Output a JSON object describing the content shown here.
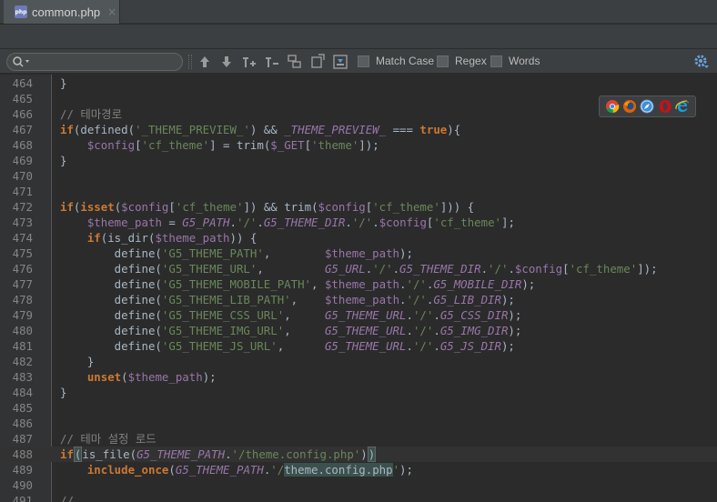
{
  "tab": {
    "label": "common.php",
    "close": "×",
    "icon": "php-file-icon",
    "icon_text": "php"
  },
  "search": {
    "value": "",
    "placeholder": "",
    "options": [
      {
        "label": "Match Case",
        "checked": false
      },
      {
        "label": "Regex",
        "checked": false
      },
      {
        "label": "Words",
        "checked": false
      }
    ]
  },
  "toolbar_icons": [
    "previous-occurrence-icon",
    "next-occurrence-icon",
    "add-occurrence-icon",
    "remove-occurrence-icon",
    "select-all-occurrences-icon",
    "filter-icon",
    "in-selection-icon"
  ],
  "browsers": [
    "chrome-icon",
    "firefox-icon",
    "safari-icon",
    "opera-icon",
    "ie-icon"
  ],
  "colors": {
    "keyword": "#cc7832",
    "string": "#6a8759",
    "variable": "#9876aa",
    "comment": "#808080",
    "text": "#a9b7c6",
    "background": "#2b2b2b",
    "gutter": "#313335"
  },
  "editor": {
    "current_line": 488,
    "lines": [
      {
        "n": "464",
        "tokens": [
          [
            "op",
            "}"
          ]
        ]
      },
      {
        "n": "465",
        "tokens": []
      },
      {
        "n": "466",
        "tokens": [
          [
            "cm",
            "// 테마경로"
          ]
        ]
      },
      {
        "n": "467",
        "tokens": [
          [
            "kw",
            "if"
          ],
          [
            "op",
            "(defined("
          ],
          [
            "str",
            "'_THEME_PREVIEW_'"
          ],
          [
            "op",
            ") && "
          ],
          [
            "const",
            "_THEME_PREVIEW_"
          ],
          [
            "op",
            " === "
          ],
          [
            "kw",
            "true"
          ],
          [
            "op",
            "){"
          ]
        ]
      },
      {
        "n": "468",
        "tokens": [
          [
            "op",
            "    "
          ],
          [
            "var",
            "$config"
          ],
          [
            "op",
            "["
          ],
          [
            "str",
            "'cf_theme'"
          ],
          [
            "op",
            "] = trim("
          ],
          [
            "var",
            "$_GET"
          ],
          [
            "op",
            "["
          ],
          [
            "str",
            "'theme'"
          ],
          [
            "op",
            "]);"
          ]
        ]
      },
      {
        "n": "469",
        "tokens": [
          [
            "op",
            "}"
          ]
        ]
      },
      {
        "n": "470",
        "tokens": []
      },
      {
        "n": "471",
        "tokens": []
      },
      {
        "n": "472",
        "tokens": [
          [
            "kw",
            "if"
          ],
          [
            "op",
            "("
          ],
          [
            "kw",
            "isset"
          ],
          [
            "op",
            "("
          ],
          [
            "var",
            "$config"
          ],
          [
            "op",
            "["
          ],
          [
            "str",
            "'cf_theme'"
          ],
          [
            "op",
            "]) && trim("
          ],
          [
            "var",
            "$config"
          ],
          [
            "op",
            "["
          ],
          [
            "str",
            "'cf_theme'"
          ],
          [
            "op",
            "])) {"
          ]
        ]
      },
      {
        "n": "473",
        "tokens": [
          [
            "op",
            "    "
          ],
          [
            "var",
            "$theme_path"
          ],
          [
            "op",
            " = "
          ],
          [
            "const",
            "G5_PATH"
          ],
          [
            "op",
            "."
          ],
          [
            "str",
            "'/'"
          ],
          [
            "op",
            "."
          ],
          [
            "const",
            "G5_THEME_DIR"
          ],
          [
            "op",
            "."
          ],
          [
            "str",
            "'/'"
          ],
          [
            "op",
            "."
          ],
          [
            "var",
            "$config"
          ],
          [
            "op",
            "["
          ],
          [
            "str",
            "'cf_theme'"
          ],
          [
            "op",
            "];"
          ]
        ]
      },
      {
        "n": "474",
        "tokens": [
          [
            "op",
            "    "
          ],
          [
            "kw",
            "if"
          ],
          [
            "op",
            "(is_dir("
          ],
          [
            "var",
            "$theme_path"
          ],
          [
            "op",
            ")) {"
          ]
        ]
      },
      {
        "n": "475",
        "tokens": [
          [
            "op",
            "        define("
          ],
          [
            "str",
            "'G5_THEME_PATH'"
          ],
          [
            "op",
            ",        "
          ],
          [
            "var",
            "$theme_path"
          ],
          [
            "op",
            ");"
          ]
        ]
      },
      {
        "n": "476",
        "tokens": [
          [
            "op",
            "        define("
          ],
          [
            "str",
            "'G5_THEME_URL'"
          ],
          [
            "op",
            ",         "
          ],
          [
            "const",
            "G5_URL"
          ],
          [
            "op",
            "."
          ],
          [
            "str",
            "'/'"
          ],
          [
            "op",
            "."
          ],
          [
            "const",
            "G5_THEME_DIR"
          ],
          [
            "op",
            "."
          ],
          [
            "str",
            "'/'"
          ],
          [
            "op",
            "."
          ],
          [
            "var",
            "$config"
          ],
          [
            "op",
            "["
          ],
          [
            "str",
            "'cf_theme'"
          ],
          [
            "op",
            "]);"
          ]
        ]
      },
      {
        "n": "477",
        "tokens": [
          [
            "op",
            "        define("
          ],
          [
            "str",
            "'G5_THEME_MOBILE_PATH'"
          ],
          [
            "op",
            ", "
          ],
          [
            "var",
            "$theme_path"
          ],
          [
            "op",
            "."
          ],
          [
            "str",
            "'/'"
          ],
          [
            "op",
            "."
          ],
          [
            "const",
            "G5_MOBILE_DIR"
          ],
          [
            "op",
            ");"
          ]
        ]
      },
      {
        "n": "478",
        "tokens": [
          [
            "op",
            "        define("
          ],
          [
            "str",
            "'G5_THEME_LIB_PATH'"
          ],
          [
            "op",
            ",    "
          ],
          [
            "var",
            "$theme_path"
          ],
          [
            "op",
            "."
          ],
          [
            "str",
            "'/'"
          ],
          [
            "op",
            "."
          ],
          [
            "const",
            "G5_LIB_DIR"
          ],
          [
            "op",
            ");"
          ]
        ]
      },
      {
        "n": "479",
        "tokens": [
          [
            "op",
            "        define("
          ],
          [
            "str",
            "'G5_THEME_CSS_URL'"
          ],
          [
            "op",
            ",     "
          ],
          [
            "const",
            "G5_THEME_URL"
          ],
          [
            "op",
            "."
          ],
          [
            "str",
            "'/'"
          ],
          [
            "op",
            "."
          ],
          [
            "const",
            "G5_CSS_DIR"
          ],
          [
            "op",
            ");"
          ]
        ]
      },
      {
        "n": "480",
        "tokens": [
          [
            "op",
            "        define("
          ],
          [
            "str",
            "'G5_THEME_IMG_URL'"
          ],
          [
            "op",
            ",     "
          ],
          [
            "const",
            "G5_THEME_URL"
          ],
          [
            "op",
            "."
          ],
          [
            "str",
            "'/'"
          ],
          [
            "op",
            "."
          ],
          [
            "const",
            "G5_IMG_DIR"
          ],
          [
            "op",
            ");"
          ]
        ]
      },
      {
        "n": "481",
        "tokens": [
          [
            "op",
            "        define("
          ],
          [
            "str",
            "'G5_THEME_JS_URL'"
          ],
          [
            "op",
            ",      "
          ],
          [
            "const",
            "G5_THEME_URL"
          ],
          [
            "op",
            "."
          ],
          [
            "str",
            "'/'"
          ],
          [
            "op",
            "."
          ],
          [
            "const",
            "G5_JS_DIR"
          ],
          [
            "op",
            ");"
          ]
        ]
      },
      {
        "n": "482",
        "tokens": [
          [
            "op",
            "    }"
          ]
        ]
      },
      {
        "n": "483",
        "tokens": [
          [
            "op",
            "    "
          ],
          [
            "kw",
            "unset"
          ],
          [
            "op",
            "("
          ],
          [
            "var",
            "$theme_path"
          ],
          [
            "op",
            ");"
          ]
        ]
      },
      {
        "n": "484",
        "tokens": [
          [
            "op",
            "}"
          ]
        ]
      },
      {
        "n": "485",
        "tokens": []
      },
      {
        "n": "486",
        "tokens": []
      },
      {
        "n": "487",
        "tokens": [
          [
            "cm",
            "// 테마 설정 로드"
          ]
        ]
      },
      {
        "n": "488",
        "tokens": [
          [
            "kw",
            "if"
          ],
          [
            "brace",
            "("
          ],
          [
            "op",
            "is_file("
          ],
          [
            "const",
            "G5_THEME_PATH"
          ],
          [
            "op",
            "."
          ],
          [
            "str",
            "'/theme.config.php'"
          ],
          [
            "op",
            ")"
          ],
          [
            "brace",
            ")"
          ]
        ]
      },
      {
        "n": "489",
        "tokens": [
          [
            "op",
            "    "
          ],
          [
            "kw",
            "include_once"
          ],
          [
            "op",
            "("
          ],
          [
            "const",
            "G5_THEME_PATH"
          ],
          [
            "op",
            "."
          ],
          [
            "str",
            "'/"
          ],
          [
            "hl",
            "theme.config.php"
          ],
          [
            "str",
            "'"
          ],
          [
            "op",
            ");"
          ]
        ]
      },
      {
        "n": "490",
        "tokens": []
      },
      {
        "n": "491",
        "tokens": [
          [
            "cm",
            "//"
          ]
        ]
      }
    ]
  }
}
